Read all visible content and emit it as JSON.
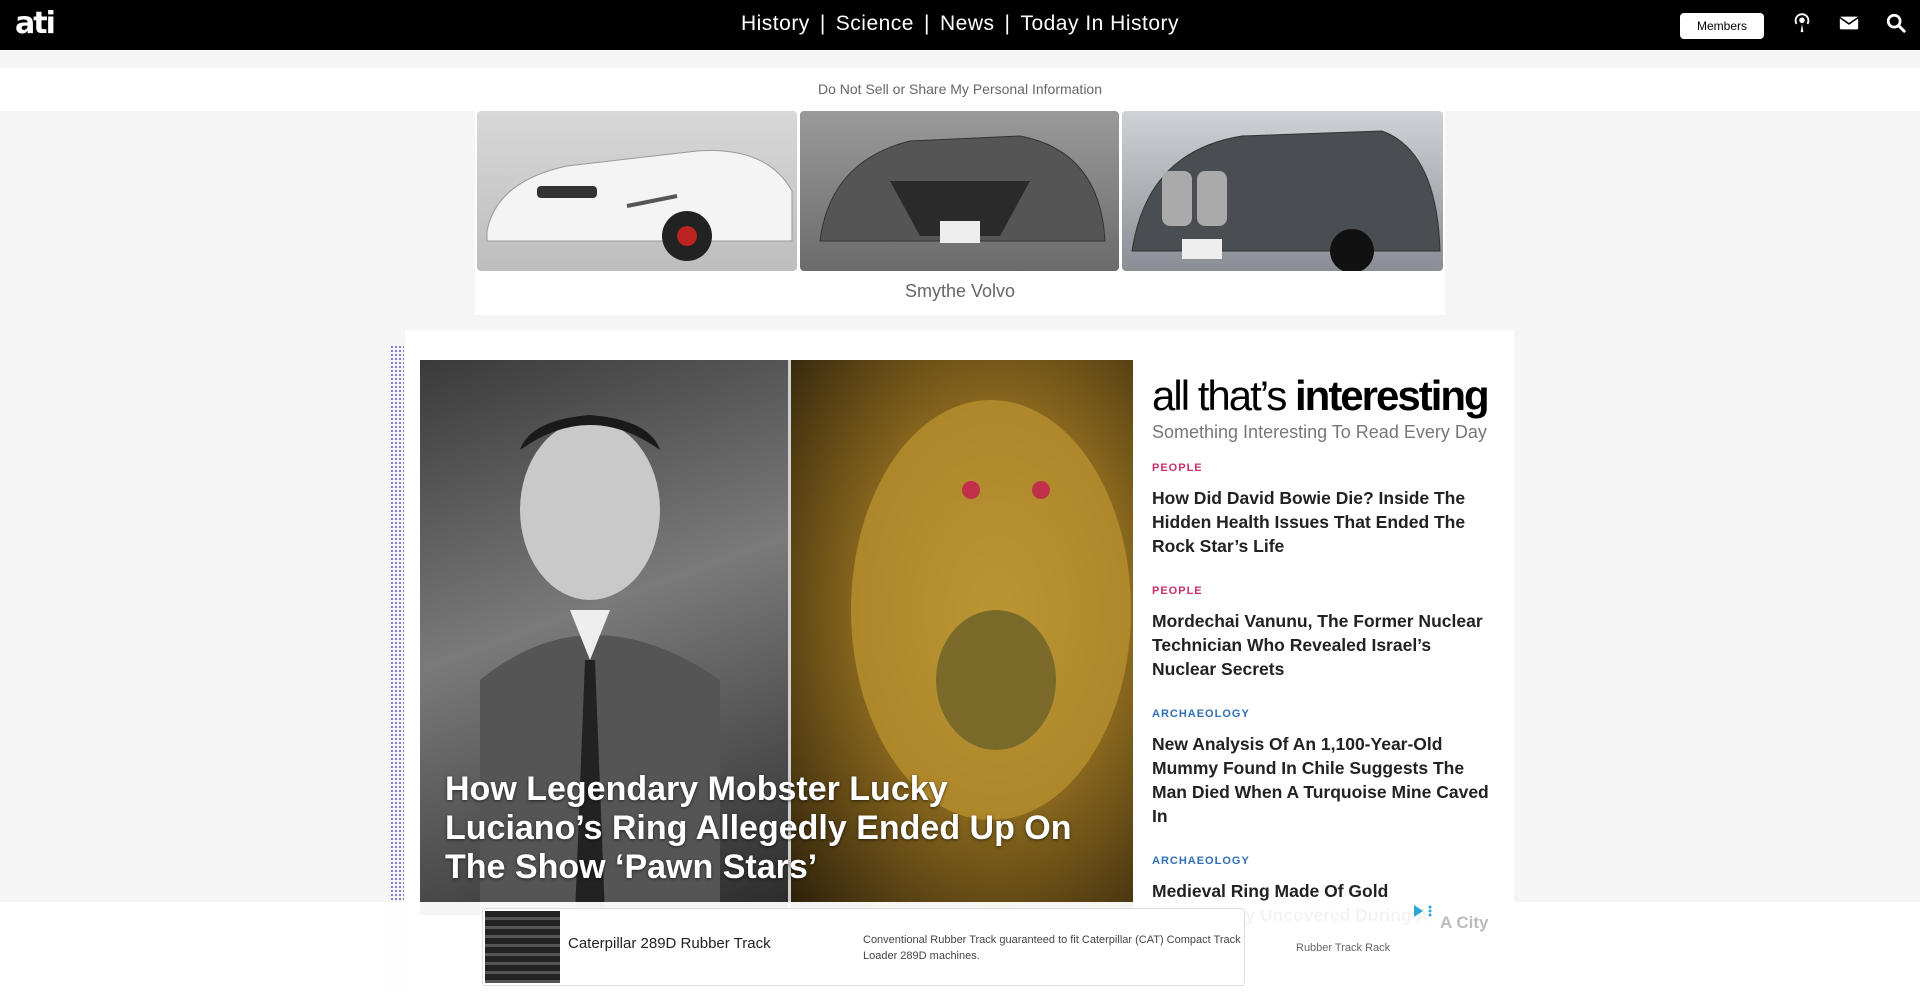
{
  "nav": {
    "logo": "ati",
    "links": [
      "History",
      "Science",
      "News",
      "Today In History"
    ],
    "separator": "|",
    "members_label": "Members",
    "icons": [
      "podcast-icon",
      "mail-icon",
      "search-icon"
    ]
  },
  "privacy": {
    "label": "Do Not Sell or Share My Personal Information"
  },
  "car_ad": {
    "caption": "Smythe Volvo"
  },
  "hero": {
    "title": "How Legendary Mobster Lucky Luciano’s Ring Allegedly Ended Up On The Show ‘Pawn Stars’"
  },
  "brand": {
    "prefix": "all that’s ",
    "strong": "interesting",
    "tagline": "Something Interesting To Read Every Day"
  },
  "articles": [
    {
      "category": "PEOPLE",
      "color": "#c8306a",
      "title": "How Did David Bowie Die? Inside The Hidden Health Issues That Ended The Rock Star’s Life"
    },
    {
      "category": "PEOPLE",
      "color": "#c8306a",
      "title": "Mordechai Vanunu, The Former Nuclear Technician Who Revealed Israel’s Nuclear Secrets"
    },
    {
      "category": "ARCHAEOLOGY",
      "color": "#2f6fb5",
      "title": "New Analysis Of An 1,100-Year-Old Mummy Found In Chile Suggests The Man Died When A Turquoise Mine Caved In"
    },
    {
      "category": "ARCHAEOLOGY",
      "color": "#2f6fb5",
      "title": "Medieval Ring Made Of Gold Accidentally Uncovered During A"
    }
  ],
  "bottom_ad": {
    "title": "Caterpillar 289D Rubber Track",
    "description": "Conventional Rubber Track guaranteed to fit Caterpillar (CAT) Compact Track Loader 289D machines.",
    "side_label": "Rubber Track Rack",
    "tail_text": "A City"
  }
}
